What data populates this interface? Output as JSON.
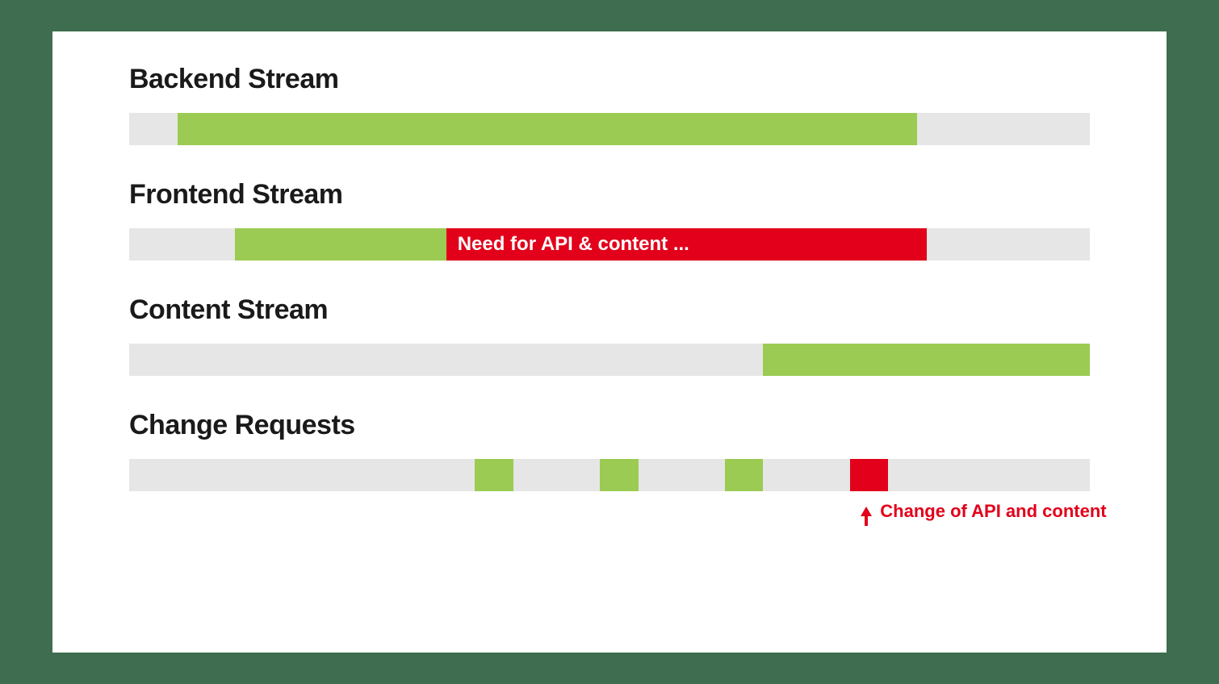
{
  "chart_data": {
    "type": "bar",
    "layout": "gantt-horizontal",
    "x_range_percent": [
      0,
      100
    ],
    "tracks": [
      {
        "name": "Backend Stream",
        "segments": [
          {
            "color": "green",
            "start": 5,
            "end": 82,
            "label": ""
          }
        ]
      },
      {
        "name": "Frontend Stream",
        "segments": [
          {
            "color": "green",
            "start": 11,
            "end": 33,
            "label": ""
          },
          {
            "color": "red",
            "start": 33,
            "end": 83,
            "label": "Need for API & content ..."
          }
        ]
      },
      {
        "name": "Content Stream",
        "segments": [
          {
            "color": "green",
            "start": 66,
            "end": 100,
            "label": ""
          }
        ]
      },
      {
        "name": "Change Requests",
        "segments": [
          {
            "color": "green",
            "start": 36,
            "end": 40,
            "label": ""
          },
          {
            "color": "green",
            "start": 49,
            "end": 53,
            "label": ""
          },
          {
            "color": "green",
            "start": 62,
            "end": 66,
            "label": ""
          },
          {
            "color": "red",
            "start": 75,
            "end": 79,
            "label": ""
          }
        ],
        "annotation": {
          "text": "Change of API and content",
          "anchor_percent": 77
        }
      }
    ]
  }
}
